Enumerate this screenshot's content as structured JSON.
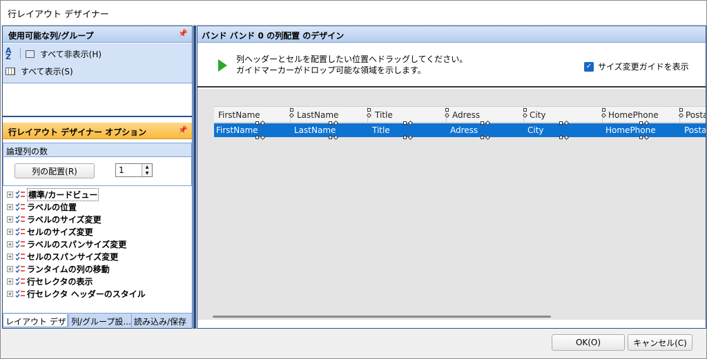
{
  "window": {
    "title": "行レイアウト デザイナー"
  },
  "columns_panel": {
    "title": "使用可能な列/グループ",
    "hide_all_label": "すべて非表示(H)",
    "show_all_label": "すべて表示(S)"
  },
  "options_panel": {
    "title": "行レイアウト デザイナー オプション",
    "logical_columns_label": "論理列の数",
    "arrange_button_label": "列の配置(R)",
    "logical_columns_value": "1",
    "tree_items": [
      "標準/カードビュー",
      "ラベルの位置",
      "ラベルのサイズ変更",
      "セルのサイズ変更",
      "ラベルのスパンサイズ変更",
      "セルのスパンサイズ変更",
      "ランタイムの列の移動",
      "行セレクタの表示",
      "行セレクタ ヘッダーのスタイル"
    ]
  },
  "left_tabs": [
    "レイアウト デザ...",
    "列/グループ設...",
    "読み込み/保存"
  ],
  "design_panel": {
    "title": "バンド バンド 0 の列配置 のデザイン",
    "instruction_line1": "列ヘッダーとセルを配置したい位置へドラッグしてください。",
    "instruction_line2": "ガイドマーカーがドロップ可能な領域を示します。",
    "show_resize_guide_label": "サイズ変更ガイドを表示",
    "show_resize_guide_checked": true,
    "columns": [
      "FirstName",
      "LastName",
      "Title",
      "Adress",
      "City",
      "HomePhone",
      "PostalCode"
    ]
  },
  "dialog_buttons": {
    "ok": "OK(O)",
    "cancel": "キャンセル(C)"
  },
  "colors": {
    "selection": "#0e72d0",
    "panel_header": "#b5cdee",
    "options_header": "#f9b93c"
  }
}
